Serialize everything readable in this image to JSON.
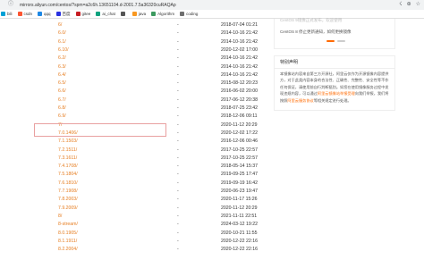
{
  "browser": {
    "url": "mirrors.aliyun.com/centos/?spm=a2c6h.13651104.d-2001.7.5a36320cuRAQAp"
  },
  "bookmarks": [
    {
      "label": "bili",
      "color": "#00a1d6"
    },
    {
      "label": "csdn",
      "color": "#fc5531"
    },
    {
      "label": "qqq",
      "color": "#1e88e5"
    },
    {
      "label": "百度",
      "color": "#2932e1"
    },
    {
      "label": "gitee",
      "color": "#c71d23"
    },
    {
      "label": "ai_chat",
      "color": "#10a37f"
    },
    {
      "label": "",
      "color": "#555555"
    },
    {
      "label": "java",
      "color": "#f89820"
    },
    {
      "label": "Algorithm",
      "color": "#3c9a5f"
    },
    {
      "label": "coding",
      "color": "#6e6e6e"
    }
  ],
  "listing": {
    "rows": [
      {
        "name": "6/",
        "size": "-",
        "date": "2018-07-04 01:21"
      },
      {
        "name": "6.0/",
        "size": "-",
        "date": "2014-10-16 21:42"
      },
      {
        "name": "6.1/",
        "size": "-",
        "date": "2014-10-16 21:42"
      },
      {
        "name": "6.10/",
        "size": "-",
        "date": "2020-12-02 17:00"
      },
      {
        "name": "6.2/",
        "size": "-",
        "date": "2014-10-16 21:42"
      },
      {
        "name": "6.3/",
        "size": "-",
        "date": "2014-10-16 21:42"
      },
      {
        "name": "6.4/",
        "size": "-",
        "date": "2014-10-16 21:42"
      },
      {
        "name": "6.5/",
        "size": "-",
        "date": "2015-08-12 20:23"
      },
      {
        "name": "6.6/",
        "size": "-",
        "date": "2016-06-02 20:00"
      },
      {
        "name": "6.7/",
        "size": "-",
        "date": "2017-06-12 20:38"
      },
      {
        "name": "6.8/",
        "size": "-",
        "date": "2018-07-25 23:42"
      },
      {
        "name": "6.9/",
        "size": "-",
        "date": "2018-12-06 09:11"
      },
      {
        "name": "7/",
        "size": "-",
        "date": "2020-11-12 20:29"
      },
      {
        "name": "7.0.1406/",
        "size": "-",
        "date": "2020-12-02 17:22"
      },
      {
        "name": "7.1.1503/",
        "size": "-",
        "date": "2016-12-06 00:46"
      },
      {
        "name": "7.2.1511/",
        "size": "-",
        "date": "2017-10-25 22:57"
      },
      {
        "name": "7.3.1611/",
        "size": "-",
        "date": "2017-10-25 22:57"
      },
      {
        "name": "7.4.1708/",
        "size": "-",
        "date": "2018-05-14 15:37"
      },
      {
        "name": "7.5.1804/",
        "size": "-",
        "date": "2019-09-25 17:47"
      },
      {
        "name": "7.6.1810/",
        "size": "-",
        "date": "2019-09-19 16:42"
      },
      {
        "name": "7.7.1908/",
        "size": "-",
        "date": "2020-06-23 19:47"
      },
      {
        "name": "7.8.2003/",
        "size": "-",
        "date": "2020-11-17 15:26"
      },
      {
        "name": "7.9.2009/",
        "size": "-",
        "date": "2020-11-12 20:29"
      },
      {
        "name": "8/",
        "size": "-",
        "date": "2021-11-11 22:51"
      },
      {
        "name": "8-stream/",
        "size": "-",
        "date": "2024-03-12 19:22"
      },
      {
        "name": "8.0.1905/",
        "size": "-",
        "date": "2020-10-21 11:55"
      },
      {
        "name": "8.1.1911/",
        "size": "-",
        "date": "2020-12-22 22:16"
      },
      {
        "name": "8.2.2004/",
        "size": "-",
        "date": "2020-12-22 22:16"
      }
    ]
  },
  "sidebar": {
    "top_line1": "CentOS 9镜像正式发布，欢迎使用",
    "top_line2": "CentOS 8 停止更新通知，如何更换镜像",
    "section_title": "特别声明",
    "body_1": "本镜像站内容来自第三方开源社，阿里云仅作为开源镜像内容提",
    "body_2": "供方，对于此类内容本身的合法性、正确性、完整性、安全性",
    "body_3": "等不作任何保证，请使用前自行判断甄别。如您在使用镜像服务",
    "body_4": "过程中发现违规内容，可以通过",
    "link_1": "阿里云镜像站举报受理",
    "body_5": "向我们举报，我们",
    "body_6": "将按照",
    "link_2": "阿里云服务协议",
    "body_7": "等相关规定进行处理。"
  }
}
